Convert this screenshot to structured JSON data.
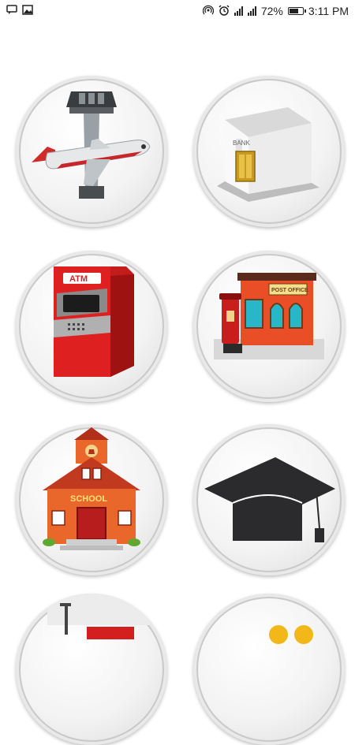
{
  "status_bar": {
    "icons_left": [
      "chat-icon",
      "image-icon"
    ],
    "icons_right": [
      "hotspot-icon",
      "alarm-icon",
      "signal-icon",
      "signal-icon",
      "battery-icon"
    ],
    "battery_percent": "72%",
    "battery_level": 0.72,
    "time": "3:11 PM"
  },
  "tiles": [
    {
      "icon": "airport-icon"
    },
    {
      "icon": "bank-icon",
      "text": "BANK"
    },
    {
      "icon": "atm-icon",
      "text": "ATM"
    },
    {
      "icon": "post-office-icon",
      "text": "POST OFFICE"
    },
    {
      "icon": "school-icon",
      "text": "SCHOOL"
    },
    {
      "icon": "graduation-cap-icon"
    },
    {
      "icon": "red-building-icon"
    },
    {
      "icon": "yellow-icon"
    }
  ]
}
